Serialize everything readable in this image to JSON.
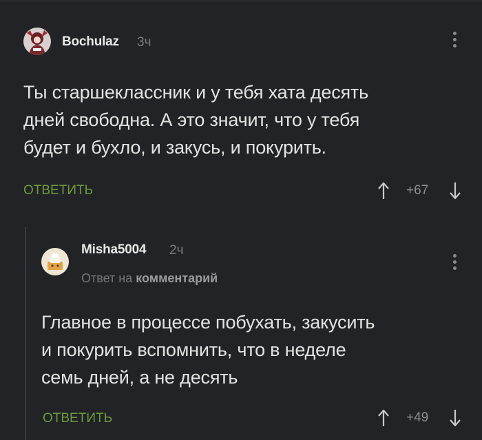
{
  "comments": [
    {
      "author": "Bochulaz",
      "time": "3ч",
      "text_lines": [
        "Ты старшеклассник и у тебя хата десять",
        "дней свободна. А это значит, что у тебя",
        "будет и бухло, и закусь, и покурить."
      ],
      "reply_label": "ОТВЕТИТЬ",
      "rating": "+67"
    },
    {
      "author": "Misha5004",
      "time": "2ч",
      "reply_to_prefix": "Ответ на",
      "reply_to_target": "комментарий",
      "text_lines": [
        "Главное в процессе побухать, закусить",
        "и покурить вспомнить, что в неделе",
        "семь дней, а не десять"
      ],
      "reply_label": "ОТВЕТИТЬ",
      "rating": "+49"
    }
  ],
  "colors": {
    "background": "#222326",
    "reply_accent": "#6d9a3b",
    "muted": "#7b7c80"
  },
  "icons": {
    "menu": "more-vertical-icon",
    "upvote": "arrow-up-icon",
    "downvote": "arrow-down-icon"
  }
}
